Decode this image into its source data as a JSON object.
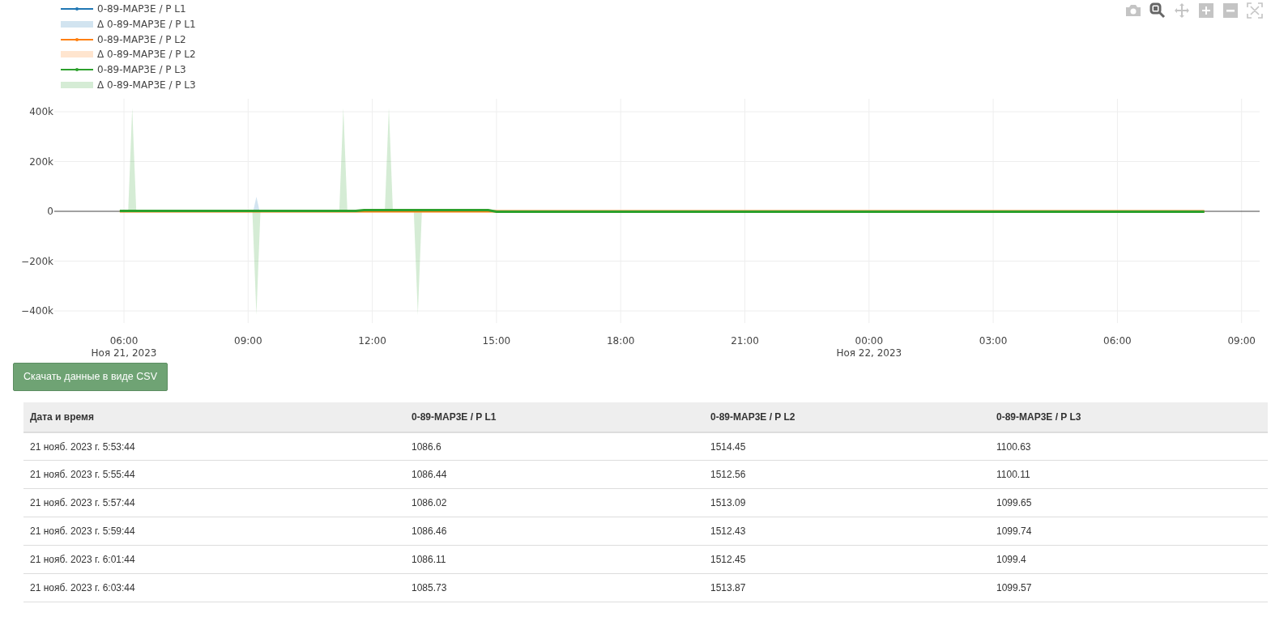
{
  "modebar": [
    {
      "kind": "camera",
      "selected": false
    },
    {
      "kind": "zoom",
      "selected": true
    },
    {
      "kind": "pan",
      "selected": false
    },
    {
      "kind": "zoom-in",
      "selected": false
    },
    {
      "kind": "zoom-out",
      "selected": false
    },
    {
      "kind": "autoscale",
      "selected": false
    }
  ],
  "chart": {
    "legend": [
      {
        "label": "0-89-MAP3E / P L1",
        "color": "#1f77b4",
        "kind": "line"
      },
      {
        "label": "Δ 0-89-MAP3E / P L1",
        "color": "#d2e4f0",
        "kind": "band"
      },
      {
        "label": "0-89-MAP3E / P L2",
        "color": "#ff7f0e",
        "kind": "line"
      },
      {
        "label": "Δ 0-89-MAP3E / P L2",
        "color": "#ffe5cf",
        "kind": "band"
      },
      {
        "label": "0-89-MAP3E / P L3",
        "color": "#2ca02c",
        "kind": "line"
      },
      {
        "label": "Δ 0-89-MAP3E / P L3",
        "color": "#d5ecd5",
        "kind": "band"
      }
    ],
    "y_ticks": [
      "400k",
      "200k",
      "0",
      "−200k",
      "−400k"
    ],
    "x_ticks": [
      {
        "time": "06:00",
        "date": "Ноя 21, 2023"
      },
      {
        "time": "09:00"
      },
      {
        "time": "12:00"
      },
      {
        "time": "15:00"
      },
      {
        "time": "18:00"
      },
      {
        "time": "21:00"
      },
      {
        "time": "00:00",
        "date": "Ноя 22, 2023"
      },
      {
        "time": "03:00"
      },
      {
        "time": "06:00"
      },
      {
        "time": "09:00"
      }
    ]
  },
  "download_button": "Скачать данные в виде CSV",
  "table": {
    "columns": [
      "Дата и время",
      "0-89-MAP3E / P L1",
      "0-89-MAP3E / P L2",
      "0-89-MAP3E / P L3"
    ],
    "rows": [
      [
        "21 нояб. 2023 г. 5:53:44",
        "1086.6",
        "1514.45",
        "1100.63"
      ],
      [
        "21 нояб. 2023 г. 5:55:44",
        "1086.44",
        "1512.56",
        "1100.11"
      ],
      [
        "21 нояб. 2023 г. 5:57:44",
        "1086.02",
        "1513.09",
        "1099.65"
      ],
      [
        "21 нояб. 2023 г. 5:59:44",
        "1086.46",
        "1512.43",
        "1099.74"
      ],
      [
        "21 нояб. 2023 г. 6:01:44",
        "1086.11",
        "1512.45",
        "1099.4"
      ],
      [
        "21 нояб. 2023 г. 6:03:44",
        "1085.73",
        "1513.87",
        "1099.57"
      ]
    ]
  }
}
